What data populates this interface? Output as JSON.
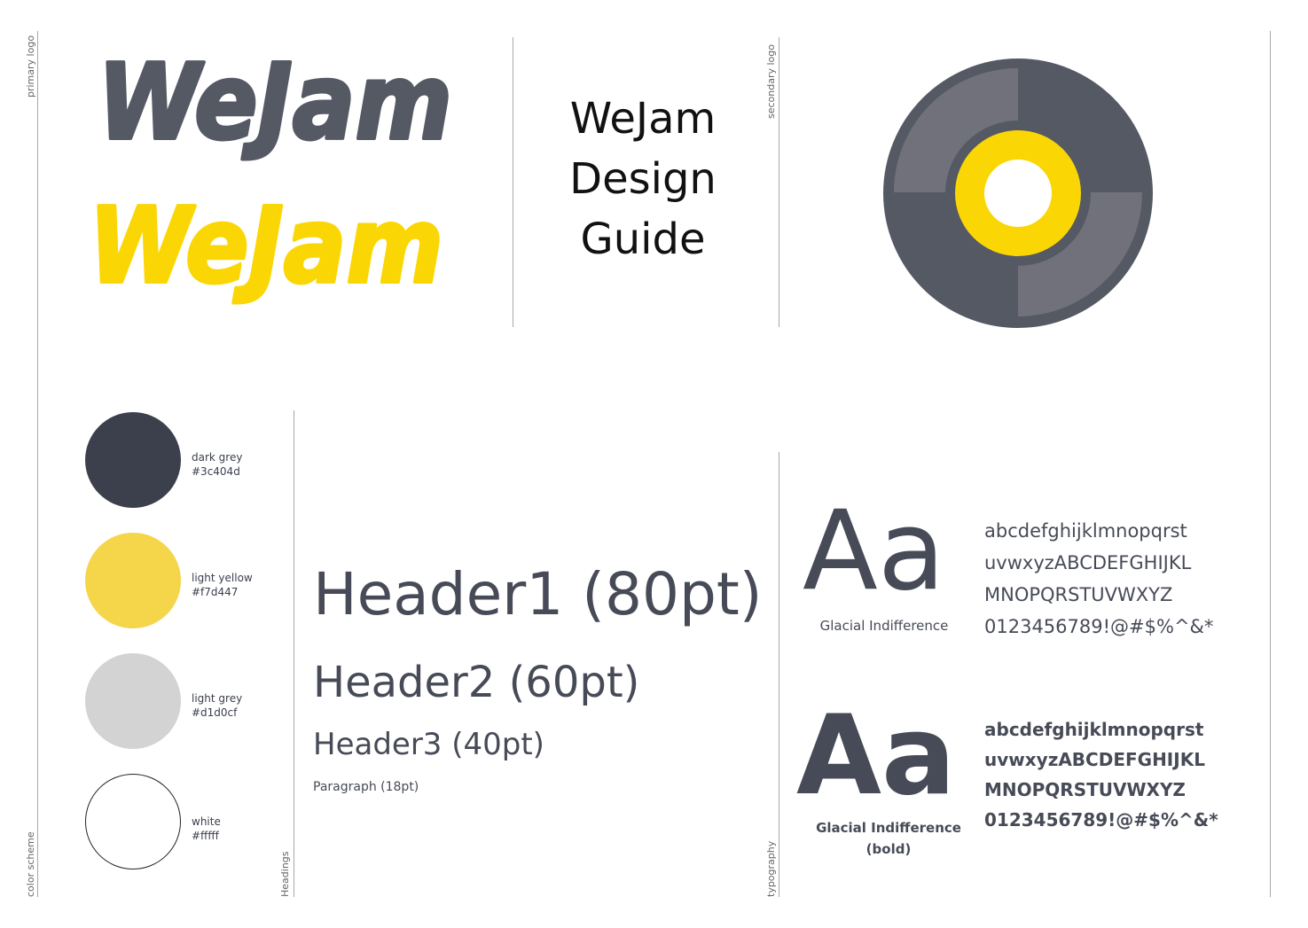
{
  "labels": {
    "primary_logo": "primary logo",
    "secondary_logo": "secondary logo",
    "color_scheme": "color scheme",
    "headings": "Headings",
    "typography": "typography"
  },
  "logo": {
    "text": "WeJam",
    "dark_color": "#545964",
    "yellow_color": "#fbd605"
  },
  "title": {
    "line1": "WeJam",
    "line2": "Design",
    "line3": "Guide"
  },
  "secondary_logo": {
    "outer_color": "#545964",
    "segment_color": "#71717c",
    "ring_color": "#fbd605",
    "center_color": "#ffffff"
  },
  "colors": [
    {
      "name": "dark grey",
      "hex": "#3c404d",
      "fill": "#3c404d"
    },
    {
      "name": "light yellow",
      "hex": "#f7d447",
      "fill": "#f5d54a"
    },
    {
      "name": "light grey",
      "hex": "#d1d0cf",
      "fill": "#d3d3d3"
    },
    {
      "name": "white",
      "hex": "#fffff",
      "fill": "#ffffff"
    }
  ],
  "headings": {
    "h1": "Header1 (80pt)",
    "h2": "Header2 (60pt)",
    "h3": "Header3 (40pt)",
    "p": "Paragraph (18pt)"
  },
  "typography": {
    "regular": {
      "sample": "Aa",
      "name": "Glacial Indifference",
      "lines": [
        "abcdefghijklmnopqrst",
        "uvwxyzABCDEFGHIJKL",
        "MNOPQRSTUVWXYZ",
        "0123456789!@#$%^&*"
      ]
    },
    "bold": {
      "sample": "Aa",
      "name_line1": "Glacial Indifference",
      "name_line2": "(bold)",
      "lines": [
        "abcdefghijklmnopqrst",
        "uvwxyzABCDEFGHIJKL",
        "MNOPQRSTUVWXYZ",
        "0123456789!@#$%^&*"
      ]
    }
  }
}
